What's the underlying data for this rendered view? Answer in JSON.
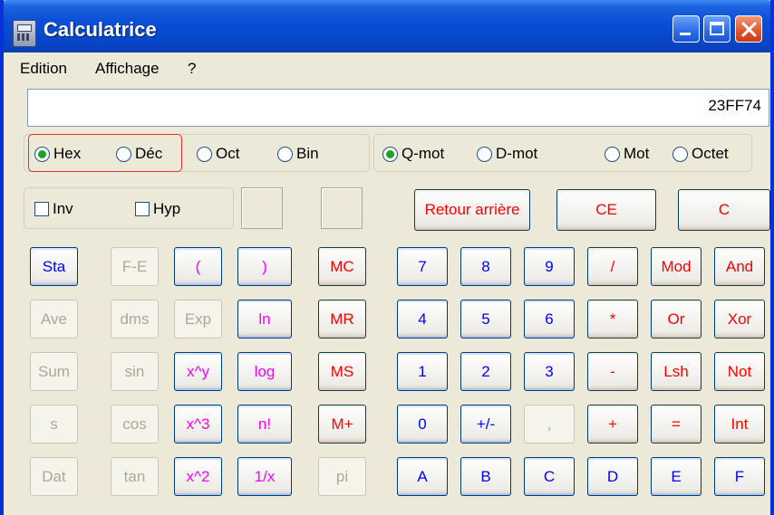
{
  "window": {
    "title": "Calculatrice",
    "icon": "calculator-icon"
  },
  "menu": [
    "Edition",
    "Affichage",
    "?"
  ],
  "display": {
    "value": "23FF74"
  },
  "base": [
    "Hex",
    "Déc",
    "Oct",
    "Bin"
  ],
  "word_size": [
    "Q-mot",
    "D-mot",
    "Mot",
    "Octet"
  ],
  "checks": {
    "inv": "Inv",
    "hyp": "Hyp"
  },
  "controls": {
    "backspace": "Retour arrière",
    "ce": "CE",
    "c": "C"
  },
  "stat": [
    "Sta",
    "Ave",
    "Sum",
    "s",
    "Dat"
  ],
  "sci1": [
    "F-E",
    "dms",
    "sin",
    "cos",
    "tan"
  ],
  "sci2": [
    "(",
    "Exp",
    "x^y",
    "x^3",
    "x^2"
  ],
  "sci3": [
    ")",
    "ln",
    "log",
    "n!",
    "1/x"
  ],
  "memory": [
    "MC",
    "MR",
    "MS",
    "M+",
    "pi"
  ],
  "digits": [
    [
      "7",
      "8",
      "9",
      "/",
      "Mod",
      "And"
    ],
    [
      "4",
      "5",
      "6",
      "*",
      "Or",
      "Xor"
    ],
    [
      "1",
      "2",
      "3",
      "-",
      "Lsh",
      "Not"
    ],
    [
      "0",
      "+/-",
      ",",
      "+",
      "=",
      "Int"
    ],
    [
      "A",
      "B",
      "C",
      "D",
      "E",
      "F"
    ]
  ],
  "colors": {
    "titlebar": "#0a4fd6",
    "blue_text": "#0000ff",
    "red_text": "#ff0000",
    "purple_text": "#ff00ff",
    "disabled_text": "#aca899"
  }
}
